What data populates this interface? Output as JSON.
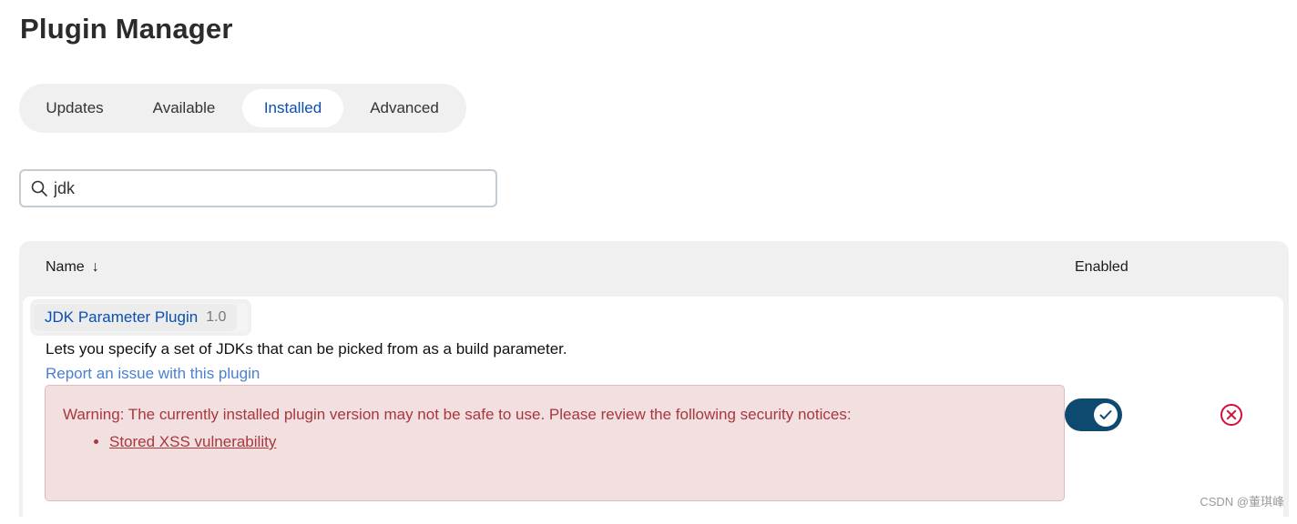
{
  "page": {
    "title": "Plugin Manager"
  },
  "tabs": [
    {
      "label": "Updates",
      "active": false
    },
    {
      "label": "Available",
      "active": false
    },
    {
      "label": "Installed",
      "active": true
    },
    {
      "label": "Advanced",
      "active": false
    }
  ],
  "search": {
    "value": "jdk",
    "icon": "search-icon"
  },
  "table": {
    "columns": {
      "name": "Name",
      "sort_indicator": "↓",
      "enabled": "Enabled"
    },
    "rows": [
      {
        "name": "JDK Parameter Plugin",
        "version": "1.0",
        "description": "Lets you specify a set of JDKs that can be picked from as a build parameter.",
        "report_link": "Report an issue with this plugin",
        "warning": {
          "text": "Warning: The currently installed plugin version may not be safe to use. Please review the following security notices:",
          "notices": [
            "Stored XSS vulnerability"
          ]
        },
        "enabled": true,
        "uninstall_icon": "close-circle-icon"
      }
    ]
  },
  "colors": {
    "accent": "#0b4eb2",
    "warning_text": "#a9373d",
    "warning_bg": "#f2dfe0",
    "toggle_on": "#0e4a70",
    "uninstall": "#d0103a"
  },
  "watermark": "CSDN @董琪峰"
}
